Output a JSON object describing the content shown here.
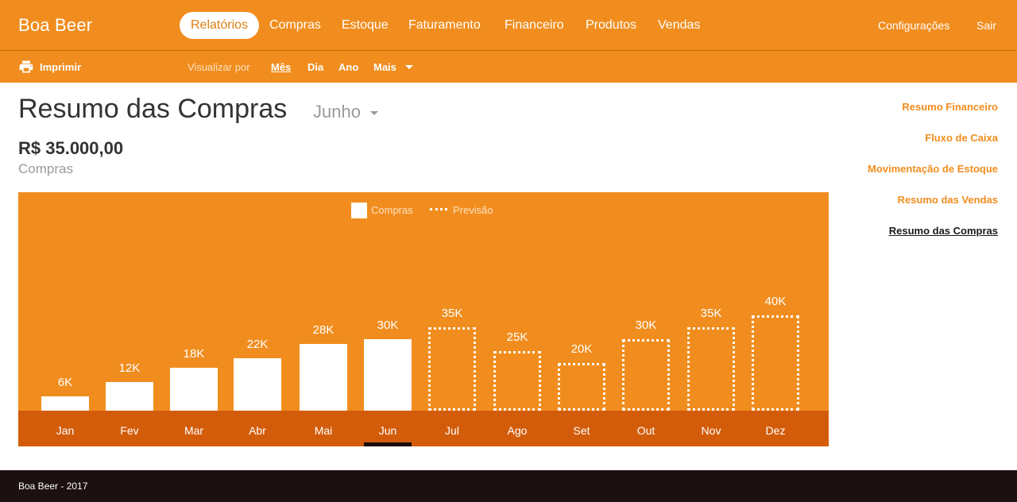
{
  "brand": "Boa Beer",
  "nav": {
    "items": [
      "Relatórios",
      "Compras",
      "Estoque",
      "Faturamento",
      "Financeiro",
      "Produtos",
      "Vendas"
    ],
    "active": "Relatórios",
    "right": [
      "Configurações",
      "Sair"
    ]
  },
  "subbar": {
    "print_label": "Imprimir",
    "view_by_label": "Visualizar por",
    "options": [
      "Mês",
      "Dia",
      "Ano",
      "Mais"
    ],
    "selected": "Mês"
  },
  "page": {
    "title": "Resumo das Compras",
    "month": "Junho",
    "amount": "R$ 35.000,00",
    "amount_label": "Compras"
  },
  "sidebar": {
    "links": [
      "Resumo Financeiro",
      "Fluxo de Caixa",
      "Movimentação de Estoque",
      "Resumo das Vendas",
      "Resumo das Compras"
    ],
    "current": "Resumo das Compras"
  },
  "chart_data": {
    "type": "bar",
    "categories": [
      "Jan",
      "Fev",
      "Mar",
      "Abr",
      "Mai",
      "Jun",
      "Jul",
      "Ago",
      "Set",
      "Out",
      "Nov",
      "Dez"
    ],
    "series": [
      {
        "name": "Compras",
        "values": [
          6,
          12,
          18,
          22,
          28,
          30,
          null,
          null,
          null,
          null,
          null,
          null
        ]
      },
      {
        "name": "Previsão",
        "values": [
          null,
          null,
          null,
          null,
          null,
          null,
          35,
          25,
          20,
          30,
          35,
          40
        ]
      }
    ],
    "data_labels": [
      "6K",
      "12K",
      "18K",
      "22K",
      "28K",
      "30K",
      "35K",
      "25K",
      "20K",
      "30K",
      "35K",
      "40K"
    ],
    "legend": [
      "Compras",
      "Previsão"
    ],
    "legend_position": "top-center",
    "selected_category": "Jun",
    "unit": "K",
    "title": "",
    "xlabel": "",
    "ylabel": ""
  },
  "footer": "Boa Beer - 2017",
  "colors": {
    "brand_orange": "#f18d1e",
    "axis_band": "#d35c0a",
    "footer_bg": "#1c1010",
    "link_orange": "#f18d1e"
  },
  "icons": {
    "print": "printer-icon",
    "dropdown": "caret-down-icon"
  }
}
